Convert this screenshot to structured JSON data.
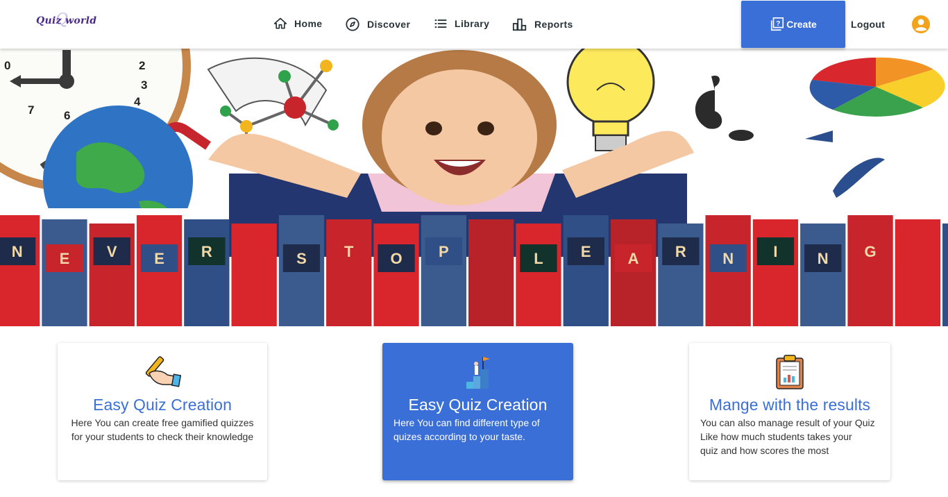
{
  "header": {
    "logo_text": "Quiz world",
    "nav": [
      {
        "label": "Home",
        "icon": "home-icon"
      },
      {
        "label": "Discover",
        "icon": "compass-icon"
      },
      {
        "label": "Library",
        "icon": "list-icon"
      },
      {
        "label": "Reports",
        "icon": "bar-chart-icon"
      }
    ],
    "create_label": "Create",
    "logout_label": "Logout",
    "account_icon": "account-circle-icon"
  },
  "hero": {
    "banner_letters": [
      "N",
      "E",
      "V",
      "E",
      "R",
      "S",
      "T",
      "O",
      "P",
      "L",
      "E",
      "A",
      "R",
      "N",
      "I",
      "N",
      "G"
    ]
  },
  "cards": [
    {
      "title": "Easy Quiz Creation",
      "desc_lines": [
        "Here You can create free gamified quizzes",
        "for your students to check their knowledge"
      ],
      "icon": "hand-writing-icon"
    },
    {
      "title": "Easy Quiz Creation",
      "desc_lines": [
        "Here You can find different type of",
        "quizes according to your taste."
      ],
      "icon": "goal-stairs-icon"
    },
    {
      "title": "Mange with the results",
      "desc_lines": [
        "You can also manage result of your Quiz",
        "Like how much students takes your",
        "quiz and how scores the most"
      ],
      "icon": "clipboard-report-icon"
    }
  ],
  "colors": {
    "accent": "#3a6fd8",
    "nav_text": "#263238",
    "account": "#f2a21b"
  }
}
